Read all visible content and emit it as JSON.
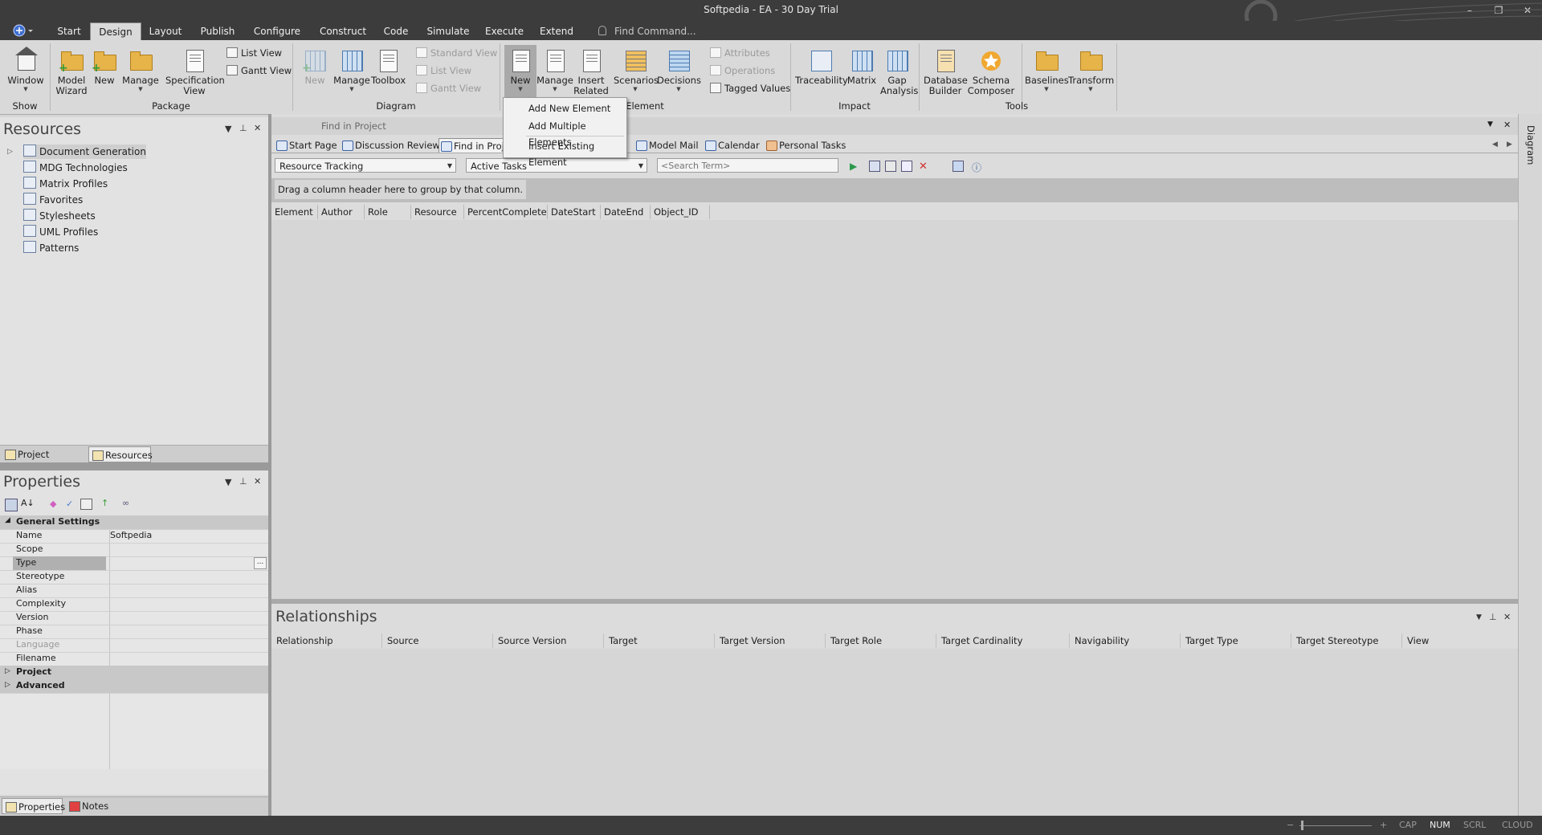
{
  "window": {
    "title": "Softpedia - EA - 30 Day Trial",
    "minimize_glyph": "–",
    "restore_glyph": "❐",
    "close_glyph": "✕"
  },
  "menu": {
    "tabs": [
      {
        "label": "Start"
      },
      {
        "label": "Design",
        "active": true
      },
      {
        "label": "Layout"
      },
      {
        "label": "Publish"
      },
      {
        "label": "Configure"
      },
      {
        "label": "Construct"
      },
      {
        "label": "Code"
      },
      {
        "label": "Simulate"
      },
      {
        "label": "Execute"
      },
      {
        "label": "Extend"
      }
    ],
    "find_command": "Find Command..."
  },
  "ribbon": {
    "groups": {
      "show": "Show",
      "package": "Package",
      "diagram": "Diagram",
      "element": "Element",
      "impact": "Impact",
      "tools": "Tools"
    },
    "window": "Window",
    "model_wizard_1": "Model",
    "model_wizard_2": "Wizard",
    "pkg_new": "New",
    "pkg_manage": "Manage",
    "spec_view_1": "Specification",
    "spec_view_2": "View",
    "list_view": "List View",
    "gantt_view": "Gantt View",
    "diag_new": "New",
    "diag_manage": "Manage",
    "toolbox": "Toolbox",
    "standard_view": "Standard View",
    "diag_list_view": "List View",
    "diag_gantt_view": "Gantt View",
    "el_new": "New",
    "el_manage": "Manage",
    "insert_related_1": "Insert",
    "insert_related_2": "Related",
    "scenarios": "Scenarios",
    "decisions": "Decisions",
    "attributes": "Attributes",
    "operations": "Operations",
    "tagged_values": "Tagged Values",
    "traceability": "Traceability",
    "matrix": "Matrix",
    "gap_analysis_1": "Gap",
    "gap_analysis_2": "Analysis",
    "db_builder_1": "Database",
    "db_builder_2": "Builder",
    "schema_composer_1": "Schema",
    "schema_composer_2": "Composer",
    "baselines": "Baselines",
    "transform": "Transform"
  },
  "new_dropdown": {
    "items": [
      "Add New Element",
      "Add Multiple Elements",
      "Insert Existing Element"
    ]
  },
  "resources": {
    "title": "Resources",
    "items": [
      "Document Generation",
      "MDG Technologies",
      "Matrix Profiles",
      "Favorites",
      "Stylesheets",
      "UML Profiles",
      "Patterns"
    ],
    "bottom_tabs": [
      "Project Browser",
      "Resources"
    ]
  },
  "properties": {
    "title": "Properties",
    "general_settings": "General Settings",
    "rows": [
      {
        "key": "Name",
        "value": "Softpedia"
      },
      {
        "key": "Scope",
        "value": ""
      },
      {
        "key": "Type",
        "value": ""
      },
      {
        "key": "Stereotype",
        "value": ""
      },
      {
        "key": "Alias",
        "value": ""
      },
      {
        "key": "Complexity",
        "value": ""
      },
      {
        "key": "Version",
        "value": ""
      },
      {
        "key": "Phase",
        "value": ""
      },
      {
        "key": "Language",
        "value": ""
      },
      {
        "key": "Filename",
        "value": ""
      }
    ],
    "ellipsis": "...",
    "categories": [
      "Project",
      "Advanced"
    ],
    "bottom_tabs": [
      "Properties",
      "Notes"
    ]
  },
  "find_in_project": {
    "header": "Find in Project",
    "tabs": [
      "Start Page",
      "Discussion Review",
      "Find in Project",
      "Model Mail",
      "Calendar",
      "Personal Tasks"
    ],
    "search_category": "Resource Tracking",
    "search_name": "Active Tasks",
    "search_placeholder": "<Search Term>",
    "group_hint": "Drag a column header here to group by that column.",
    "columns": [
      "Element",
      "Author",
      "Role",
      "Resource",
      "PercentComplete",
      "DateStart",
      "DateEnd",
      "Object_ID"
    ]
  },
  "relationships": {
    "title": "Relationships",
    "columns": [
      "Relationship",
      "Source",
      "Source Version",
      "Target",
      "Target Version",
      "Target Role",
      "Target Cardinality",
      "Navigability",
      "Target Type",
      "Target Stereotype",
      "View"
    ]
  },
  "side_tab": "Diagram",
  "status": {
    "zoom_minus": "−",
    "zoom_plus": "+",
    "cap": "CAP",
    "num": "NUM",
    "scrl": "SCRL",
    "cloud": "CLOUD"
  }
}
